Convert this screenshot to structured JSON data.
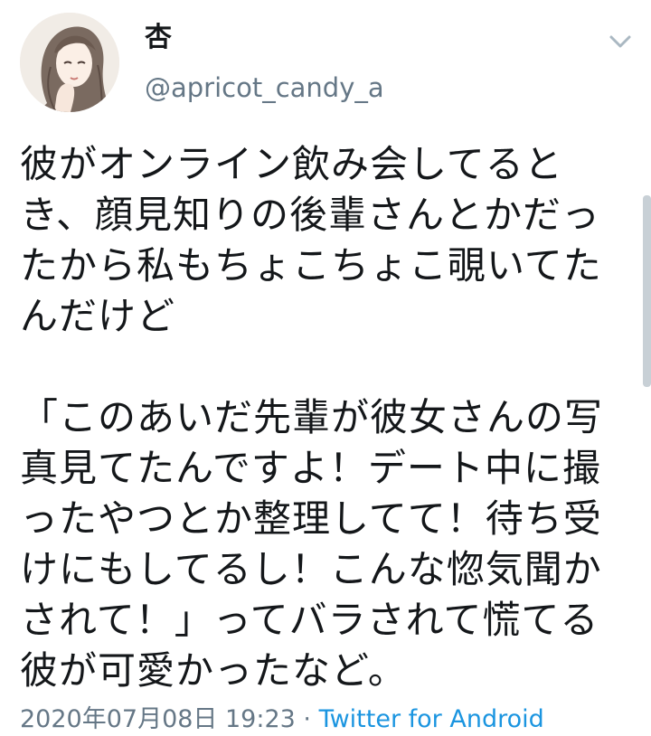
{
  "tweet": {
    "display_name": "杏",
    "handle": "@apricot_candy_a",
    "avatar_icon": "avatar-illustration-icon",
    "menu_icon": "chevron-down-icon",
    "text": "彼がオンライン飲み会してると\nき、顔見知りの後輩さんとかだっ\nたから私もちょこちょこ覗いてた\nんだけど\n\n「このあいだ先輩が彼女さんの写\n真見てたんですよ！デート中に撮\nったやつとか整理してて！待ち受\nけにもしてるし！こんな惚気聞か\nされて！」ってバラされて慌てる\n彼が可愛かったなど。",
    "timestamp": "2020年07月08日 19:23",
    "separator": " · ",
    "source": "Twitter for Android"
  },
  "colors": {
    "text": "#14171a",
    "secondary": "#657786",
    "link": "#1b95e0",
    "background": "#ffffff"
  }
}
